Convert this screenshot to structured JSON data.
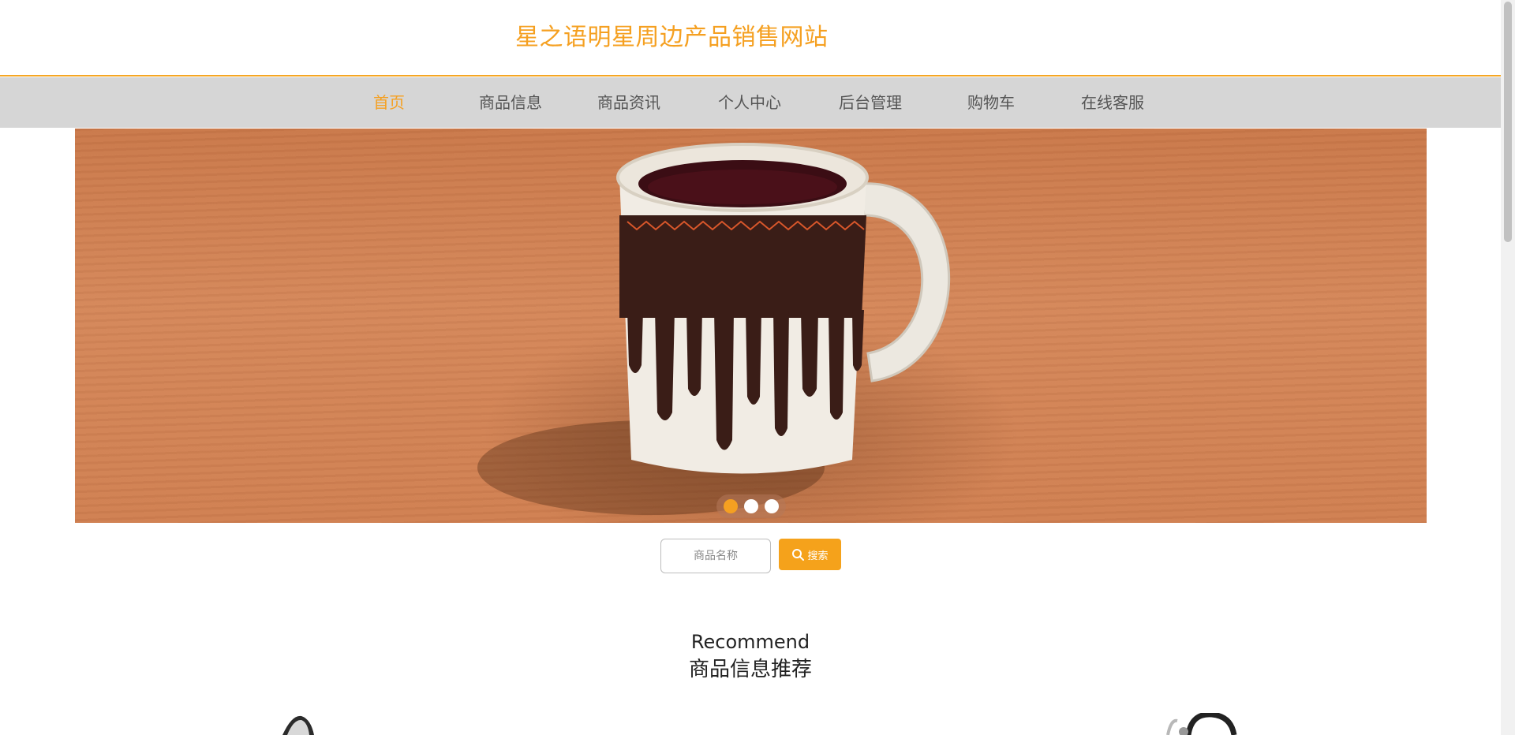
{
  "site": {
    "title": "星之语明星周边产品销售网站"
  },
  "nav": {
    "items": [
      {
        "label": "首页",
        "active": true
      },
      {
        "label": "商品信息"
      },
      {
        "label": "商品资讯"
      },
      {
        "label": "个人中心"
      },
      {
        "label": "后台管理"
      },
      {
        "label": "购物车"
      },
      {
        "label": "在线客服"
      }
    ]
  },
  "banner": {
    "slide_count": 3,
    "active_slide": 1
  },
  "search": {
    "placeholder": "商品名称",
    "button_label": "搜索",
    "icon": "search-icon"
  },
  "recommend": {
    "title_en": "Recommend",
    "title_cn": "商品信息推荐"
  },
  "colors": {
    "accent": "#f5a021",
    "nav_background": "#d6d6d6"
  }
}
